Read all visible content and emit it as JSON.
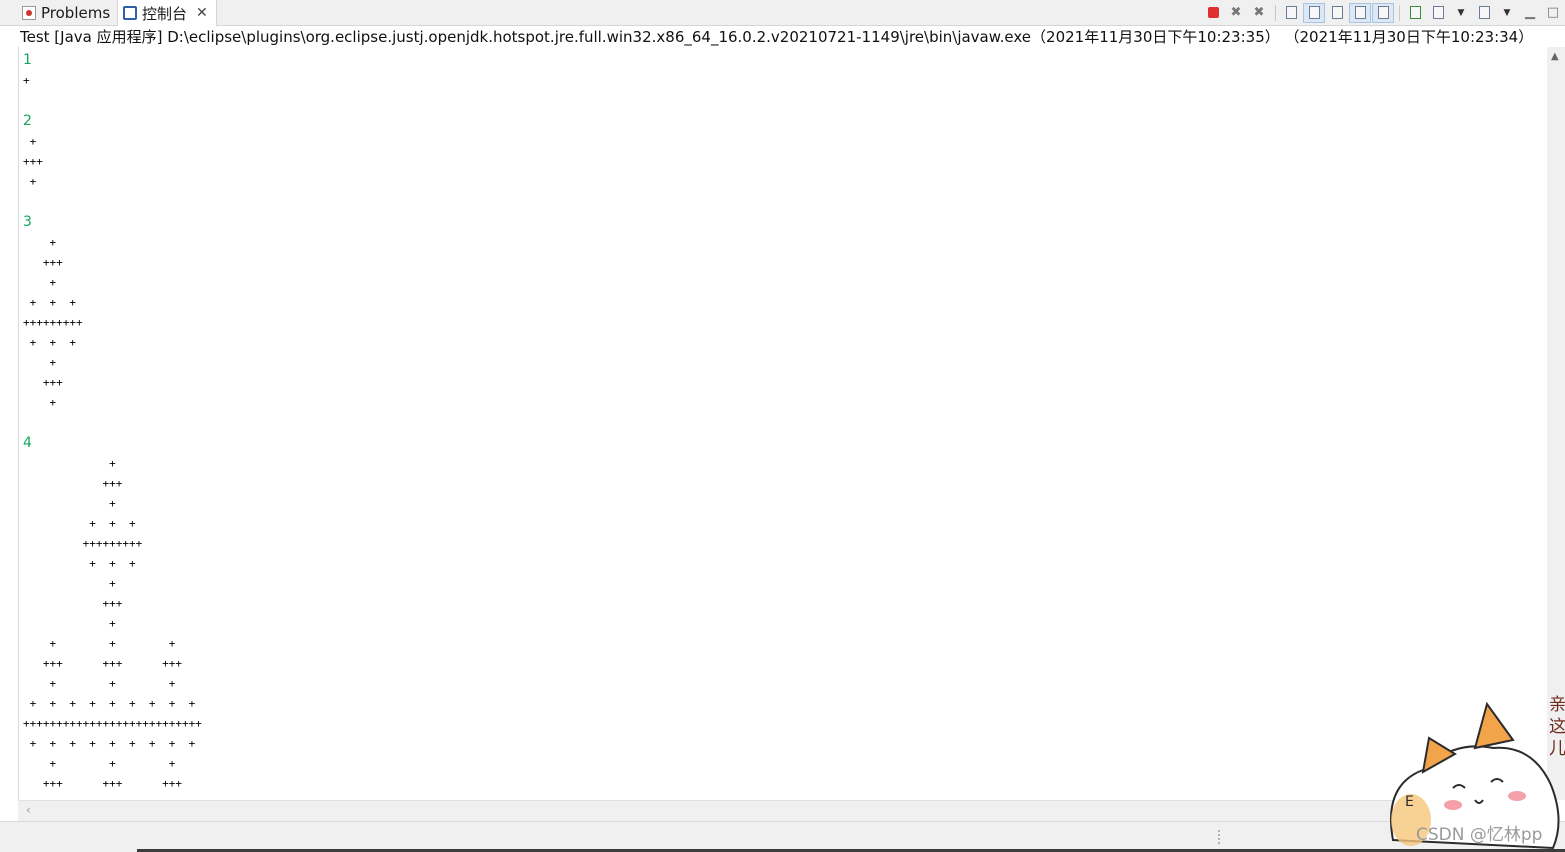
{
  "tabs": {
    "problems_label": "Problems",
    "console_label": "控制台",
    "close_glyph": "✕"
  },
  "toolbar": {
    "icons": [
      "terminate-icon",
      "remove-launch-icon",
      "remove-all-launches-icon",
      "clear-console-icon",
      "scroll-lock-icon",
      "word-wrap-icon",
      "show-on-stdout-icon",
      "show-on-stderr-icon",
      "pin-console-icon",
      "display-selected-console-icon",
      "open-console-icon",
      "minimize-icon",
      "maximize-icon"
    ]
  },
  "console": {
    "header": "Test [Java 应用程序] D:\\eclipse\\plugins\\org.eclipse.justj.openjdk.hotspot.jre.full.win32.x86_64_16.0.2.v20210721-1149\\jre\\bin\\javaw.exe（2021年11月30日下午10:23:35） （2021年11月30日下午10:23:34）",
    "output": [
      {
        "type": "num",
        "text": "1"
      },
      {
        "type": "line",
        "text": "+"
      },
      {
        "type": "line",
        "text": ""
      },
      {
        "type": "num",
        "text": "2"
      },
      {
        "type": "line",
        "text": " + "
      },
      {
        "type": "line",
        "text": "+++"
      },
      {
        "type": "line",
        "text": " + "
      },
      {
        "type": "line",
        "text": ""
      },
      {
        "type": "num",
        "text": "3"
      },
      {
        "type": "line",
        "text": "    +    "
      },
      {
        "type": "line",
        "text": "   +++   "
      },
      {
        "type": "line",
        "text": "    +    "
      },
      {
        "type": "line",
        "text": " +  +  + "
      },
      {
        "type": "line",
        "text": "+++++++++"
      },
      {
        "type": "line",
        "text": " +  +  + "
      },
      {
        "type": "line",
        "text": "    +    "
      },
      {
        "type": "line",
        "text": "   +++   "
      },
      {
        "type": "line",
        "text": "    +    "
      },
      {
        "type": "line",
        "text": ""
      },
      {
        "type": "num",
        "text": "4"
      },
      {
        "type": "line",
        "text": "             +             "
      },
      {
        "type": "line",
        "text": "            +++            "
      },
      {
        "type": "line",
        "text": "             +             "
      },
      {
        "type": "line",
        "text": "          +  +  +          "
      },
      {
        "type": "line",
        "text": "         +++++++++         "
      },
      {
        "type": "line",
        "text": "          +  +  +          "
      },
      {
        "type": "line",
        "text": "             +             "
      },
      {
        "type": "line",
        "text": "            +++            "
      },
      {
        "type": "line",
        "text": "             +             "
      },
      {
        "type": "line",
        "text": "    +        +        +    "
      },
      {
        "type": "line",
        "text": "   +++      +++      +++   "
      },
      {
        "type": "line",
        "text": "    +        +        +    "
      },
      {
        "type": "line",
        "text": " +  +  +  +  +  +  +  +  + "
      },
      {
        "type": "line",
        "text": "+++++++++++++++++++++++++++"
      },
      {
        "type": "line",
        "text": " +  +  +  +  +  +  +  +  + "
      },
      {
        "type": "line",
        "text": "    +        +        +    "
      },
      {
        "type": "line",
        "text": "   +++      +++      +++   "
      },
      {
        "type": "line",
        "text": "    +        +        +    "
      }
    ]
  },
  "watermark": {
    "text": "CSDN @忆林pp",
    "side_text": "亲这儿"
  }
}
